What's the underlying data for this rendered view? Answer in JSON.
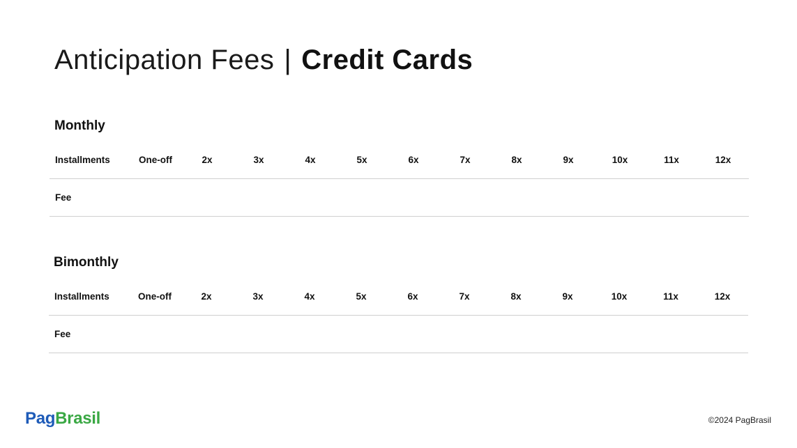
{
  "title": {
    "light": "Anticipation Fees",
    "separator": "|",
    "bold": "Credit Cards"
  },
  "sections": [
    {
      "heading": "Monthly",
      "row_label_installments": "Installments",
      "row_label_fee": "Fee",
      "columns": [
        "One-off",
        "2x",
        "3x",
        "4x",
        "5x",
        "6x",
        "7x",
        "8x",
        "9x",
        "10x",
        "11x",
        "12x"
      ],
      "fees": [
        "",
        "",
        "",
        "",
        "",
        "",
        "",
        "",
        "",
        "",
        "",
        ""
      ]
    },
    {
      "heading": "Bimonthly",
      "row_label_installments": "Installments",
      "row_label_fee": "Fee",
      "columns": [
        "One-off",
        "2x",
        "3x",
        "4x",
        "5x",
        "6x",
        "7x",
        "8x",
        "9x",
        "10x",
        "11x",
        "12x"
      ],
      "fees": [
        "",
        "",
        "",
        "",
        "",
        "",
        "",
        "",
        "",
        "",
        "",
        ""
      ]
    }
  ],
  "footer": {
    "logo_part1": "Pag",
    "logo_part2": "Brasil",
    "copyright": "©2024 PagBrasil"
  },
  "colors": {
    "logo_blue": "#1e5bb8",
    "logo_green": "#3aa844",
    "divider": "#cfcfcf"
  }
}
